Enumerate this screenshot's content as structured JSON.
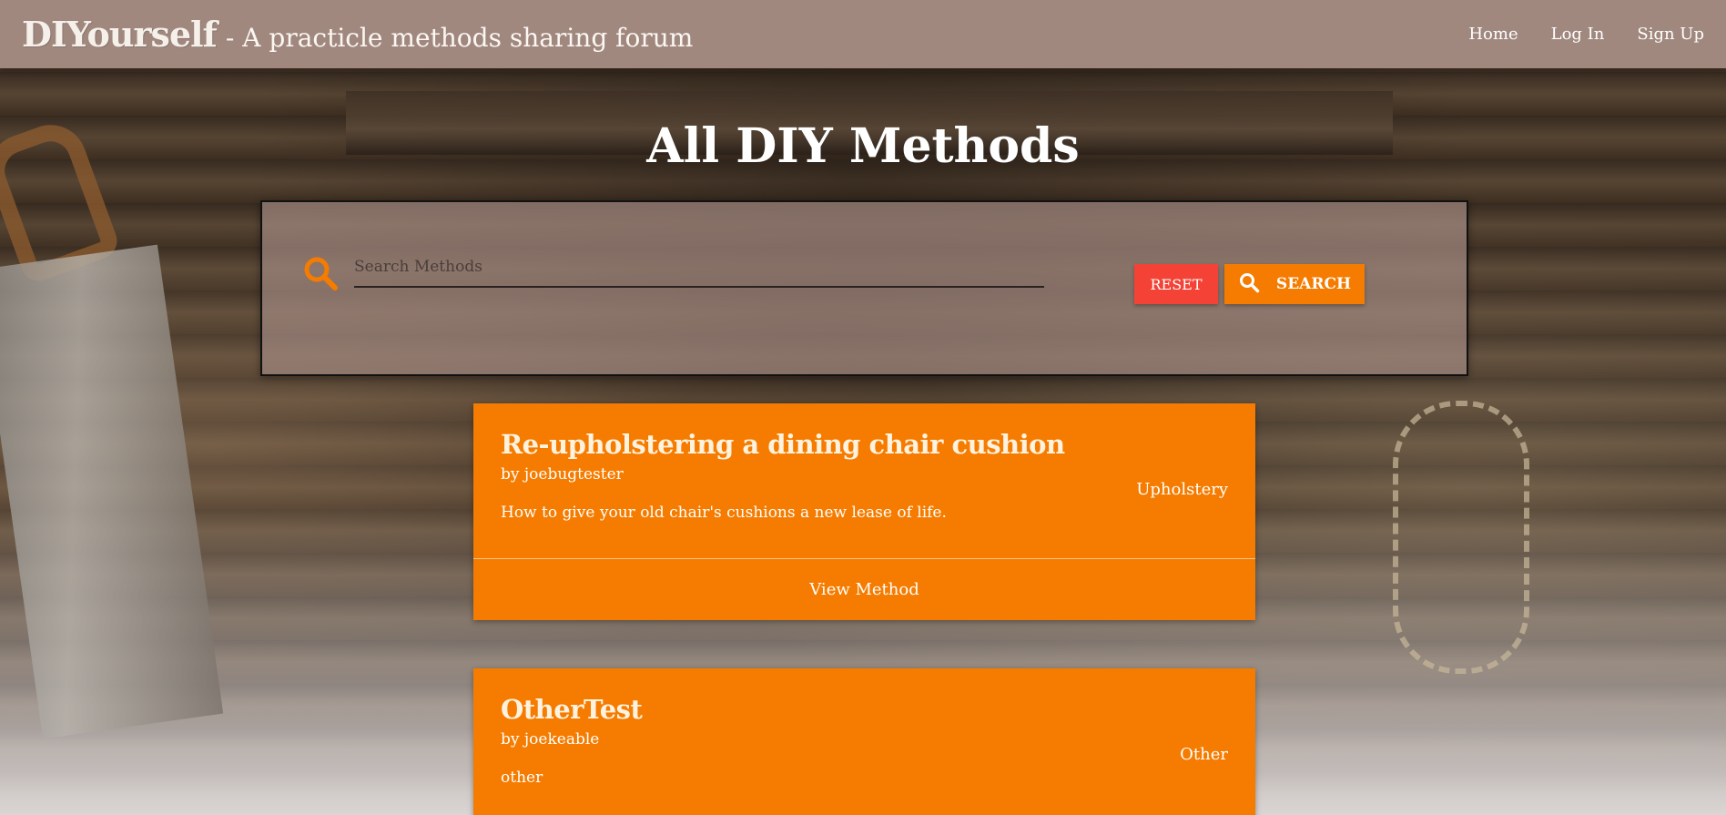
{
  "header": {
    "brand": "DIYourself",
    "tagline": "- A practicle methods sharing forum",
    "nav": [
      {
        "label": "Home"
      },
      {
        "label": "Log In"
      },
      {
        "label": "Sign Up"
      }
    ]
  },
  "page": {
    "title": "All DIY Methods"
  },
  "search": {
    "placeholder": "Search Methods",
    "value": "",
    "reset_label": "RESET",
    "search_label": "SEARCH",
    "accent_color": "#f57c00",
    "reset_color": "#f44336"
  },
  "methods": [
    {
      "title": "Re-upholstering a dining chair cushion",
      "author": "by joebugtester",
      "description": "How to give your old chair's cushions a new lease of life.",
      "category": "Upholstery",
      "action_label": "View Method"
    },
    {
      "title": "OtherTest",
      "author": "by joekeable",
      "description": "other",
      "category": "Other"
    }
  ],
  "colors": {
    "navbar": "#a1887f",
    "card": "#f57c00"
  }
}
